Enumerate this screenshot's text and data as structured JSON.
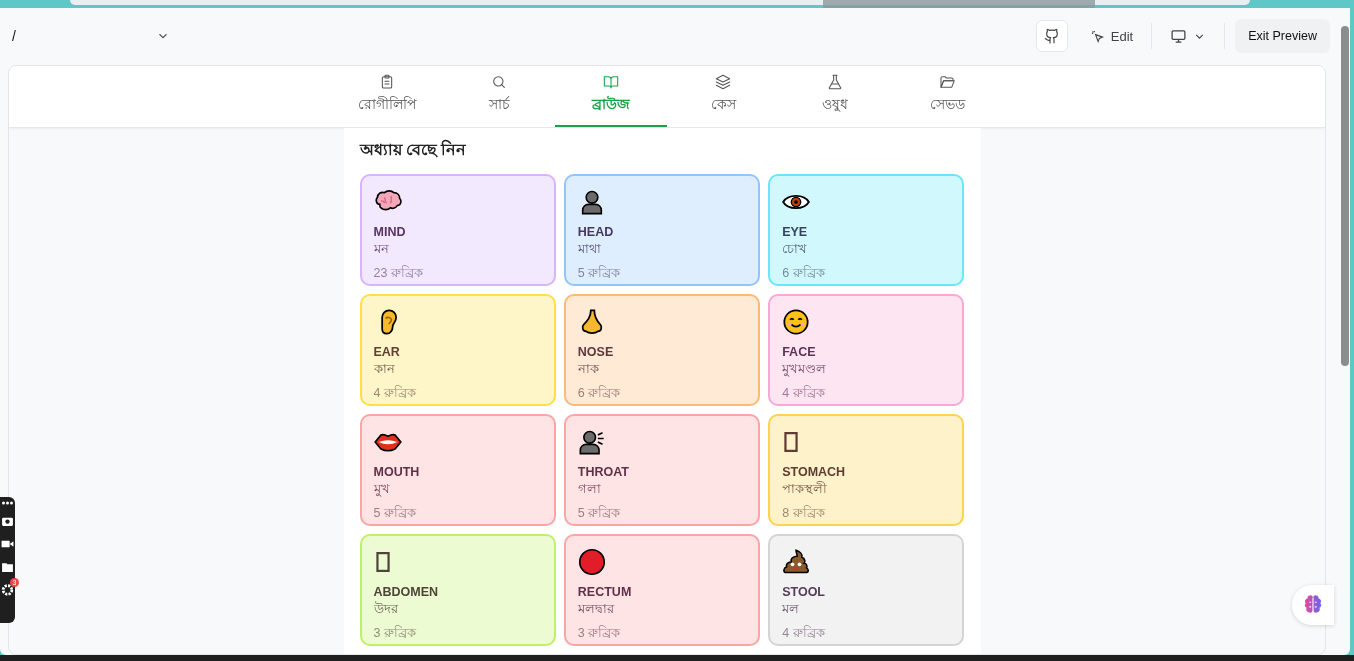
{
  "top_bar": {
    "breadcrumb": "/",
    "edit_label": "Edit",
    "exit_label": "Exit Preview"
  },
  "tabs": [
    {
      "label": "রোগীলিপি",
      "selected": false
    },
    {
      "label": "সার্চ",
      "selected": false
    },
    {
      "label": "ব্রাউজ",
      "selected": true
    },
    {
      "label": "কেস",
      "selected": false
    },
    {
      "label": "ওষুধ",
      "selected": false
    },
    {
      "label": "সেভড",
      "selected": false
    }
  ],
  "panel": {
    "title": "অধ্যায় বেছে নিন",
    "chapters": [
      {
        "name": "MIND",
        "name_bn": "মন",
        "count": "23 রুব্রিক",
        "color": "#d8b4fe"
      },
      {
        "name": "HEAD",
        "name_bn": "মাথা",
        "count": "5 রুব্রিক",
        "color": "#93c5fd"
      },
      {
        "name": "EYE",
        "name_bn": "চোখ",
        "count": "6 রুব্রিক",
        "color": "#67e8f9"
      },
      {
        "name": "EAR",
        "name_bn": "কান",
        "count": "4 রুব্রিক",
        "color": "#fde047"
      },
      {
        "name": "NOSE",
        "name_bn": "নাক",
        "count": "6 রুব্রিক",
        "color": "#fdba74"
      },
      {
        "name": "FACE",
        "name_bn": "মুখমণ্ডল",
        "count": "4 রুব্রিক",
        "color": "#f9a8d4"
      },
      {
        "name": "MOUTH",
        "name_bn": "মুখ",
        "count": "5 রুব্রিক",
        "color": "#fca5a5"
      },
      {
        "name": "THROAT",
        "name_bn": "গলা",
        "count": "5 রুব্রিক",
        "color": "#fca5a5"
      },
      {
        "name": "STOMACH",
        "name_bn": "পাকস্থলী",
        "count": "8 রুব্রিক",
        "color": "#fcd34d"
      },
      {
        "name": "ABDOMEN",
        "name_bn": "উদর",
        "count": "3 রুব্রিক",
        "color": "#bef264"
      },
      {
        "name": "RECTUM",
        "name_bn": "মলদ্বার",
        "count": "3 রুব্রিক",
        "color": "#fca5a5"
      },
      {
        "name": "STOOL",
        "name_bn": "মল",
        "count": "4 রুব্রিক",
        "color": "#d4d4d4"
      }
    ]
  },
  "side_toolbar": {
    "badge": "3"
  }
}
